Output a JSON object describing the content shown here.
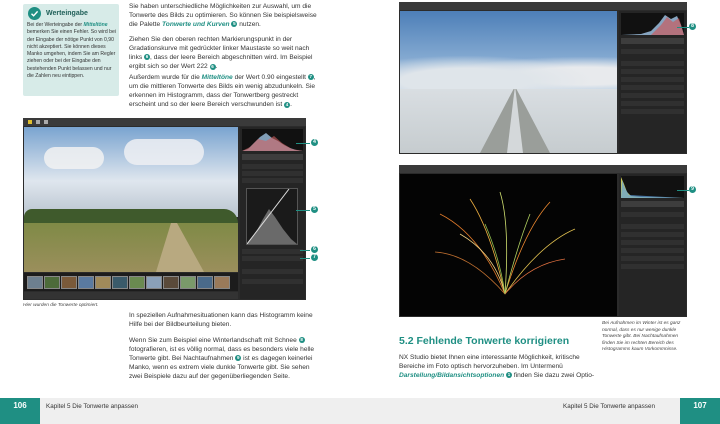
{
  "left_page": {
    "tip": {
      "icon": "check-circle-icon",
      "title": "Werteingabe",
      "body_pre": "Bei der Werteingabe der ",
      "body_link": "Mitteltöne",
      "body_post": " bemerken Sie einen Fehler. So wird bei der Eingabe der nötige Punkt von 0,90 nicht akzeptiert. Sie können dieses Manko umgehen, indem Sie am Regler ziehen oder bei der Eingabe den bestehenden Punkt belassen und nur die Zahlen neu eintippen."
    },
    "para1": "Sie haben unterschiedliche Möglichkeiten zur Auswahl, um die Tonwerte des Bilds zu optimieren. So können Sie beispielsweise die Palette",
    "para1_link": "Tonwerte und Kurven",
    "para1_badge": "5",
    "para1_end": "nutzen.",
    "para2_a": "Ziehen Sie den oberen rechten Markierungspunkt in der Gradationskurve mit gedrückter linker Maustaste so weit nach links",
    "para2_badge1": "6",
    "para2_b": ", dass der leere Bereich abgeschnitten wird. Im Beispiel ergibt sich so der Wert 222",
    "para2_badge2": "6",
    "para2_c": ".",
    "para3_a": "Außerdem wurde für die",
    "para3_link": "Mitteltöne",
    "para3_b": "der Wert 0.90 eingestellt",
    "para3_badge1": "7",
    "para3_c": ", um die mittleren Tonwerte des Bilds ein wenig abzudunkeln. Sie erkennen im Histogramm, dass der Tonwertberg gestreckt erscheint und so der leere Bereich verschwunden ist",
    "para3_badge2": "4",
    "para3_d": ".",
    "screenshot_callouts": [
      "4",
      "5",
      "6",
      "7"
    ],
    "caption": "Hier wurden die Tonwerte optimiert.",
    "para4": "In speziellen Aufnahmesituationen kann das Histogramm keine Hilfe bei der Bildbeurteilung bieten.",
    "para5_a": "Wenn Sie zum Beispiel eine Winterlandschaft mit Schnee",
    "para5_badge1": "8",
    "para5_b": "fotografieren, ist es völlig normal, dass es besonders viele helle Tonwerte gibt. Bei Nachtaufnahmen",
    "para5_badge2": "9",
    "para5_c": "ist es dagegen keinerlei Manko, wenn es extrem viele dunkle Tonwerte gibt. Sie sehen zwei Beispiele dazu auf der gegenüberliegenden Seite.",
    "page_number": "106",
    "chapter": "Kapitel 5   Die Tonwerte anpassen"
  },
  "right_page": {
    "callouts": [
      "8",
      "9"
    ],
    "caption": "Bei Aufnahmen im Winter ist es ganz normal, dass es nur wenige dunkle Tonwerte gibt. Bei Nachtaufnahmen finden Sie im rechten Bereich des Histogramms kaum Vorkommnisse.",
    "heading": "5.2  Fehlende Tonwerte korrigieren",
    "para1_a": "NX Studio bietet Ihnen eine interessante Möglichkeit, kritische Bereiche im Foto optisch hervorzuheben. Im Untermenü",
    "para1_link": "Darstellung/Bildansichtsoptionen",
    "para1_badge": "1",
    "para1_b": "finden Sie dazu zwei Optio-",
    "page_number": "107",
    "chapter": "Kapitel 5   Die Tonwerte anpassen"
  },
  "colors": {
    "accent": "#1f8f83",
    "tip_bg": "#d7ebe8",
    "footer_bg": "#efefef"
  }
}
